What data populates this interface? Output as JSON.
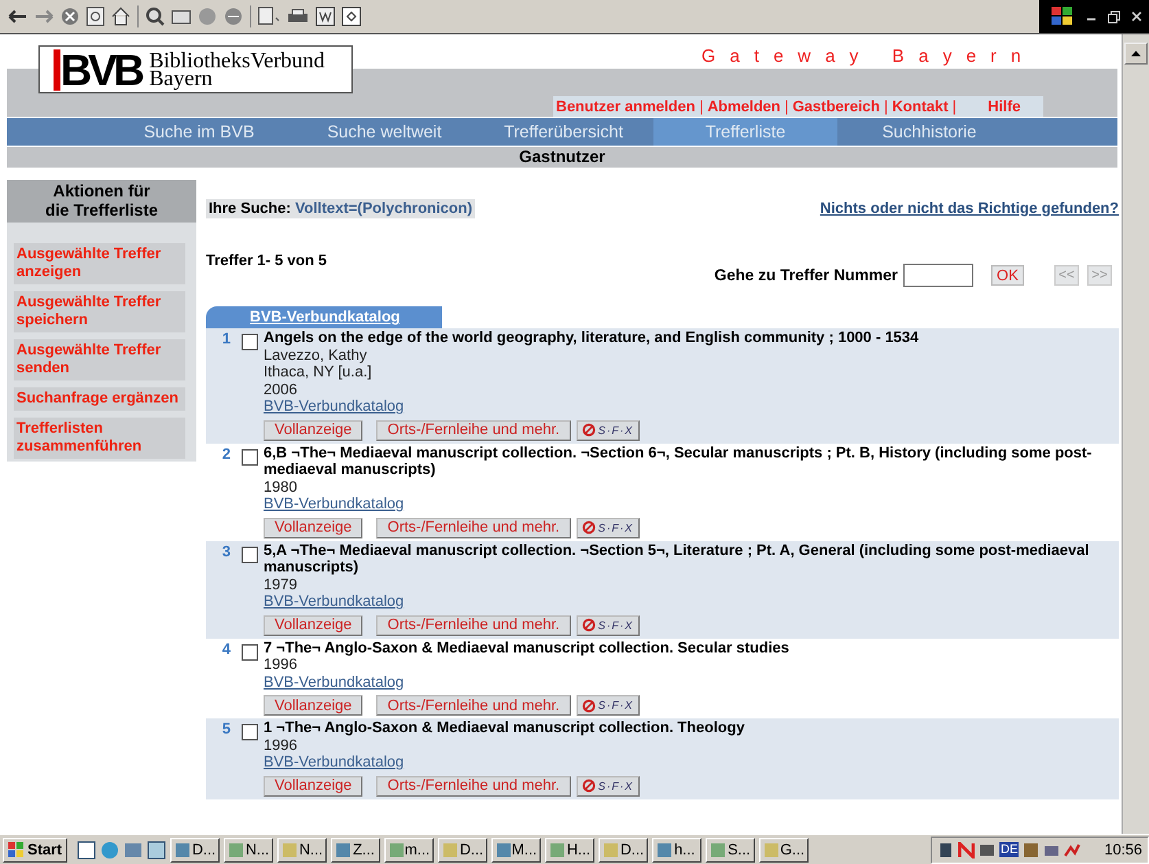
{
  "header": {
    "logo_mark": "BVB",
    "logo_lines": [
      "BibliotheksVerbund",
      "Bayern"
    ],
    "gateway_title": "Gateway Bayern"
  },
  "user_links": [
    {
      "label": "Benutzer anmelden",
      "separator": "|"
    },
    {
      "label": "Abmelden",
      "separator": "|"
    },
    {
      "label": "Gastbereich",
      "separator": "|"
    },
    {
      "label": "Kontakt",
      "separator": "|"
    },
    {
      "label": "Hilfe"
    }
  ],
  "nav_tabs": [
    {
      "label": "Suche im BVB",
      "selected": false
    },
    {
      "label": "Suche weltweit",
      "selected": false
    },
    {
      "label": "Trefferübersicht",
      "selected": false
    },
    {
      "label": "Trefferliste",
      "selected": true
    },
    {
      "label": "Suchhistorie",
      "selected": false
    }
  ],
  "user_status": "Gastnutzer",
  "sidebar": {
    "heading": "Aktionen für die Trefferliste",
    "actions": [
      "Ausgewählte Treffer anzeigen",
      "Ausgewählte Treffer speichern",
      "Ausgewählte Treffer senden",
      "Suchanfrage ergänzen",
      "Trefferlisten zusammenführen"
    ]
  },
  "search": {
    "label": "Ihre Suche:",
    "value": "Volltext=(Polychronicon)"
  },
  "help_link": "Nichts oder nicht das Richtige gefunden?",
  "hits_count": "Treffer 1- 5 von 5",
  "goto": {
    "label": "Gehe zu Treffer Nummer",
    "ok": "OK",
    "prev": "<<",
    "next": ">>"
  },
  "results_tab": "BVB-Verbundkatalog",
  "results": [
    {
      "number": "1",
      "checked": false,
      "title": "Angels on the edge of the world geography, literature, and English community ; 1000 - 1534",
      "details": [
        "Lavezzo, Kathy",
        "Ithaca, NY [u.a.]",
        "2006"
      ],
      "source": "BVB-Verbundkatalog",
      "buttons": [
        {
          "kind": "text",
          "label": "Vollanzeige"
        },
        {
          "kind": "text",
          "label": "Orts-/Fernleihe und mehr."
        },
        {
          "kind": "sfx",
          "label": "S·F·X"
        }
      ]
    },
    {
      "number": "2",
      "checked": false,
      "title": "6,B ¬The¬ Mediaeval manuscript collection. ¬Section 6¬, Secular manuscripts ; Pt. B, History (including some post-mediaeval manuscripts)",
      "details": [
        "1980"
      ],
      "source": "BVB-Verbundkatalog",
      "buttons": [
        {
          "kind": "text",
          "label": "Vollanzeige"
        },
        {
          "kind": "text",
          "label": "Orts-/Fernleihe und mehr."
        },
        {
          "kind": "sfx",
          "label": "S·F·X"
        }
      ]
    },
    {
      "number": "3",
      "checked": false,
      "title": "5,A ¬The¬ Mediaeval manuscript collection. ¬Section 5¬, Literature ; Pt. A, General (including some post-mediaeval manuscripts)",
      "details": [
        "1979"
      ],
      "source": "BVB-Verbundkatalog",
      "buttons": [
        {
          "kind": "text",
          "label": "Vollanzeige"
        },
        {
          "kind": "text",
          "label": "Orts-/Fernleihe und mehr."
        },
        {
          "kind": "sfx",
          "label": "S·F·X"
        }
      ]
    },
    {
      "number": "4",
      "checked": false,
      "title": "7 ¬The¬ Anglo-Saxon & Mediaeval manuscript collection. Secular studies",
      "details": [
        "1996"
      ],
      "source": "BVB-Verbundkatalog",
      "buttons": [
        {
          "kind": "text",
          "label": "Vollanzeige"
        },
        {
          "kind": "text",
          "label": "Orts-/Fernleihe und mehr."
        },
        {
          "kind": "sfx",
          "label": "S·F·X"
        }
      ]
    },
    {
      "number": "5",
      "checked": false,
      "title": "1 ¬The¬ Anglo-Saxon & Mediaeval manuscript collection. Theology",
      "details": [
        "1996"
      ],
      "source": "BVB-Verbundkatalog",
      "buttons": [
        {
          "kind": "text",
          "label": "Vollanzeige"
        },
        {
          "kind": "text",
          "label": "Orts-/Fernleihe und mehr."
        },
        {
          "kind": "sfx",
          "label": "S·F·X"
        }
      ]
    }
  ],
  "taskbar": {
    "start": "Start",
    "tasks": [
      "D...",
      "N...",
      "N...",
      "Z...",
      "m...",
      "D...",
      "M...",
      "H...",
      "D...",
      "h...",
      "S...",
      "G..."
    ],
    "language": "DE",
    "clock": "10:56"
  }
}
